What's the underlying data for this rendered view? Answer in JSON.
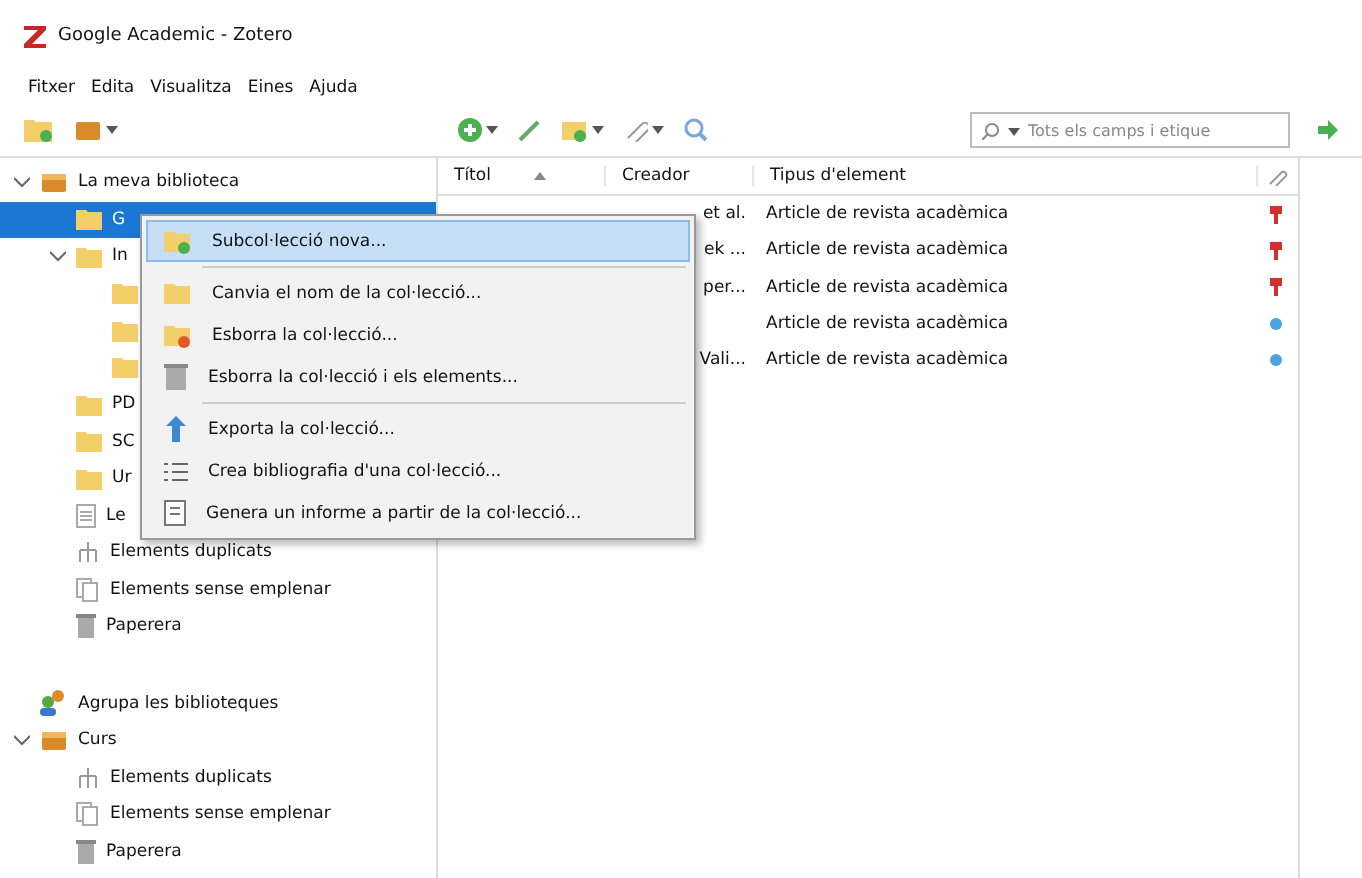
{
  "window": {
    "title": "Google Academic - Zotero"
  },
  "menu_bar": [
    "Fitxer",
    "Edita",
    "Visualitza",
    "Eines",
    "Ajuda"
  ],
  "search": {
    "placeholder": "Tots els camps i etique"
  },
  "tree": [
    {
      "label": "La meva biblioteca",
      "kind": "library",
      "expanded": true,
      "selected": false,
      "children": [
        {
          "label": "G",
          "kind": "folder",
          "selected": true
        },
        {
          "label": "In",
          "kind": "folder",
          "expanded": true,
          "selected": false,
          "children": [
            {
              "kind": "folder",
              "selected": false
            },
            {
              "kind": "folder",
              "selected": false
            },
            {
              "kind": "folder",
              "selected": false
            }
          ]
        },
        {
          "label": "PD",
          "kind": "folder",
          "selected": false
        },
        {
          "label": "SC",
          "kind": "folder",
          "selected": false
        },
        {
          "label": "Ur",
          "kind": "folder",
          "selected": false
        },
        {
          "label": "Le",
          "kind": "document",
          "selected": false
        },
        {
          "label": "Elements duplicats",
          "kind": "duplicates",
          "selected": false
        },
        {
          "label": "Elements sense emplenar",
          "kind": "unfiled",
          "selected": false
        },
        {
          "label": "Paperera",
          "kind": "trash",
          "selected": false
        }
      ]
    },
    {
      "label": "Agrupa les biblioteques",
      "kind": "groups",
      "selected": false
    },
    {
      "label": "Curs",
      "kind": "group",
      "expanded": true,
      "selected": false,
      "children": [
        {
          "label": "Elements duplicats",
          "kind": "duplicates",
          "selected": false
        },
        {
          "label": "Elements sense emplenar",
          "kind": "unfiled",
          "selected": false
        },
        {
          "label": "Paperera",
          "kind": "bin",
          "selected": false
        }
      ]
    }
  ],
  "table": {
    "columns": [
      "Títol",
      "Creador",
      "Tipus d'element"
    ],
    "rows": [
      {
        "creator": "et al.",
        "type": "Article de revista acadèmica",
        "kind": "pdf"
      },
      {
        "creator": "ek ...",
        "type": "Article de revista acadèmica",
        "kind": "pdf"
      },
      {
        "creator": "per...",
        "type": "Article de revista acadèmica",
        "kind": "pdf"
      },
      {
        "type": "Article de revista acadèmica",
        "kind": "link"
      },
      {
        "creator": "Vali...",
        "type": "Article de revista acadèmica",
        "kind": "link"
      }
    ]
  },
  "context_menu": [
    [
      {
        "label": "Subcol·lecció nova...",
        "kind": "new",
        "selected": true
      }
    ],
    [
      {
        "label": "Canvia el nom de la col·lecció...",
        "kind": "rename",
        "selected": false
      },
      {
        "label": "Esborra la col·lecció...",
        "kind": "delete",
        "selected": false
      },
      {
        "label": "Esborra la col·lecció i els elements...",
        "kind": "deleteall",
        "selected": false
      }
    ],
    [
      {
        "label": "Exporta la col·lecció...",
        "kind": "export",
        "selected": false
      },
      {
        "label": "Crea bibliografia d'una col·lecció...",
        "kind": "biblio",
        "selected": false
      },
      {
        "label": "Genera un informe a partir de la col·lecció...",
        "kind": "report",
        "selected": false
      }
    ]
  ]
}
